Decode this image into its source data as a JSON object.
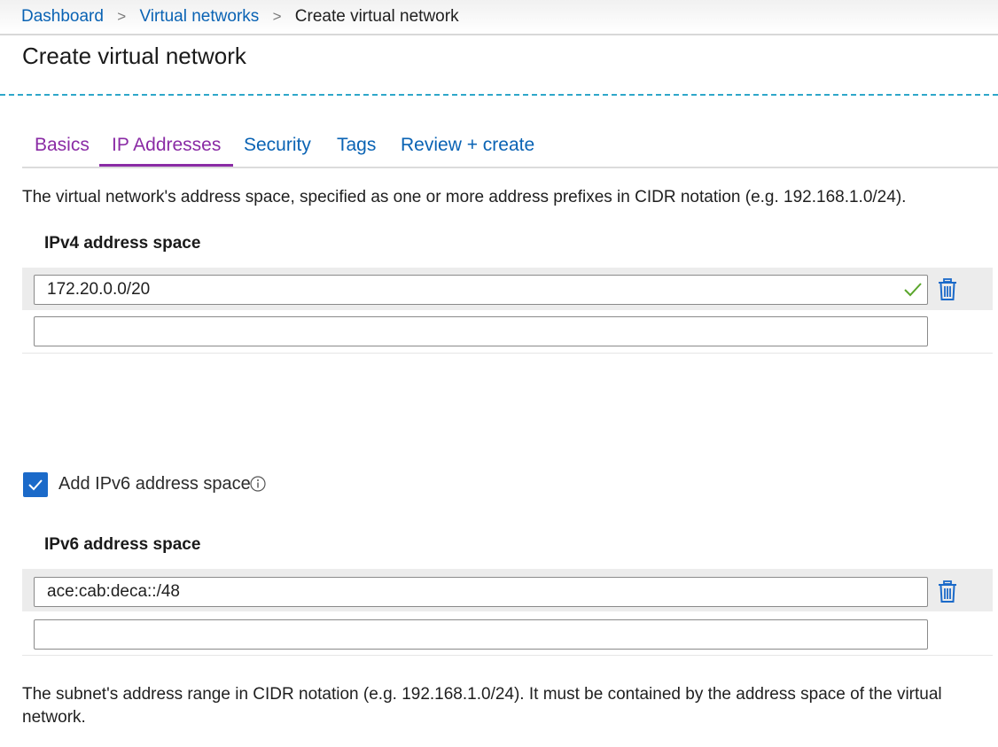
{
  "breadcrumb": {
    "items": [
      "Dashboard",
      "Virtual networks"
    ],
    "current": "Create virtual network",
    "separator": ">"
  },
  "page": {
    "title": "Create virtual network"
  },
  "tabs": [
    {
      "label": "Basics",
      "state": "visited"
    },
    {
      "label": "IP Addresses",
      "state": "active"
    },
    {
      "label": "Security",
      "state": "default"
    },
    {
      "label": "Tags",
      "state": "default"
    },
    {
      "label": "Review + create",
      "state": "default"
    }
  ],
  "address_space": {
    "description": "The virtual network's address space, specified as one or more address prefixes in CIDR notation (e.g. 192.168.1.0/24).",
    "ipv4": {
      "label": "IPv4 address space",
      "entries": [
        "172.20.0.0/20"
      ],
      "empty_entry": ""
    },
    "ipv6_toggle": {
      "label": "Add IPv6 address space",
      "checked": true,
      "info_icon": "info-icon"
    },
    "ipv6": {
      "label": "IPv6 address space",
      "entries": [
        "ace:cab:deca::/48"
      ],
      "empty_entry": ""
    }
  },
  "subnet": {
    "description": "The subnet's address range in CIDR notation (e.g. 192.168.1.0/24). It must be contained by the address space of the virtual network."
  },
  "colors": {
    "link": "#0a63b4",
    "visited_tab": "#8a2ba5",
    "checkbox": "#1b6ac9",
    "valid_check": "#5aa62c",
    "trash_icon": "#1b6ac9",
    "accent_dash": "#2fa7c9"
  },
  "icons": {
    "breadcrumb_separator": "chevron-right-icon",
    "valid": "checkmark-icon",
    "delete": "trash-icon",
    "checkbox": "checkbox-checked-icon",
    "info": "info-icon"
  }
}
